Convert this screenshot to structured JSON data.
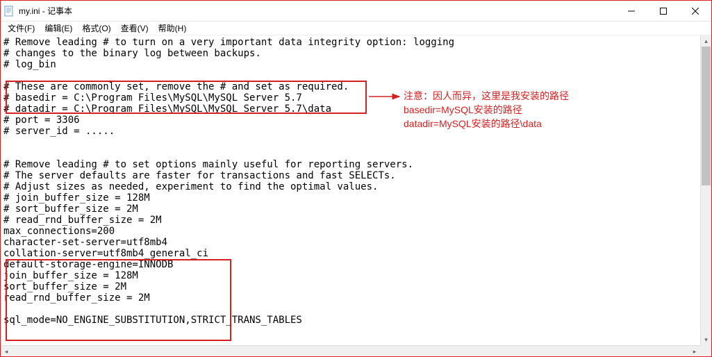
{
  "window": {
    "title": "my.ini - 记事本"
  },
  "menu": {
    "file": "文件(F)",
    "edit": "编辑(E)",
    "format": "格式(O)",
    "view": "查看(V)",
    "help": "帮助(H)"
  },
  "editor": {
    "content": "# Remove leading # to turn on a very important data integrity option: logging\n# changes to the binary log between backups.\n# log_bin\n\n# These are commonly set, remove the # and set as required.\n# basedir = C:\\Program Files\\MySQL\\MySQL Server 5.7\n# datadir = C:\\Program Files\\MySQL\\MySQL Server 5.7\\data\n# port = 3306\n# server_id = .....\n\n\n# Remove leading # to set options mainly useful for reporting servers.\n# The server defaults are faster for transactions and fast SELECTs.\n# Adjust sizes as needed, experiment to find the optimal values.\n# join_buffer_size = 128M\n# sort_buffer_size = 2M\n# read_rnd_buffer_size = 2M\nmax_connections=200\ncharacter-set-server=utf8mb4\ncollation-server=utf8mb4_general_ci\ndefault-storage-engine=INNODB\njoin_buffer_size = 128M\nsort_buffer_size = 2M\nread_rnd_buffer_size = 2M\n\nsql_mode=NO_ENGINE_SUBSTITUTION,STRICT_TRANS_TABLES"
  },
  "annotations": {
    "note1": "注意：因人而异，这里是我安装的路径",
    "note2": "basedir=MySQL安装的路径",
    "note3": "datadir=MySQL安装的路径\\data"
  }
}
